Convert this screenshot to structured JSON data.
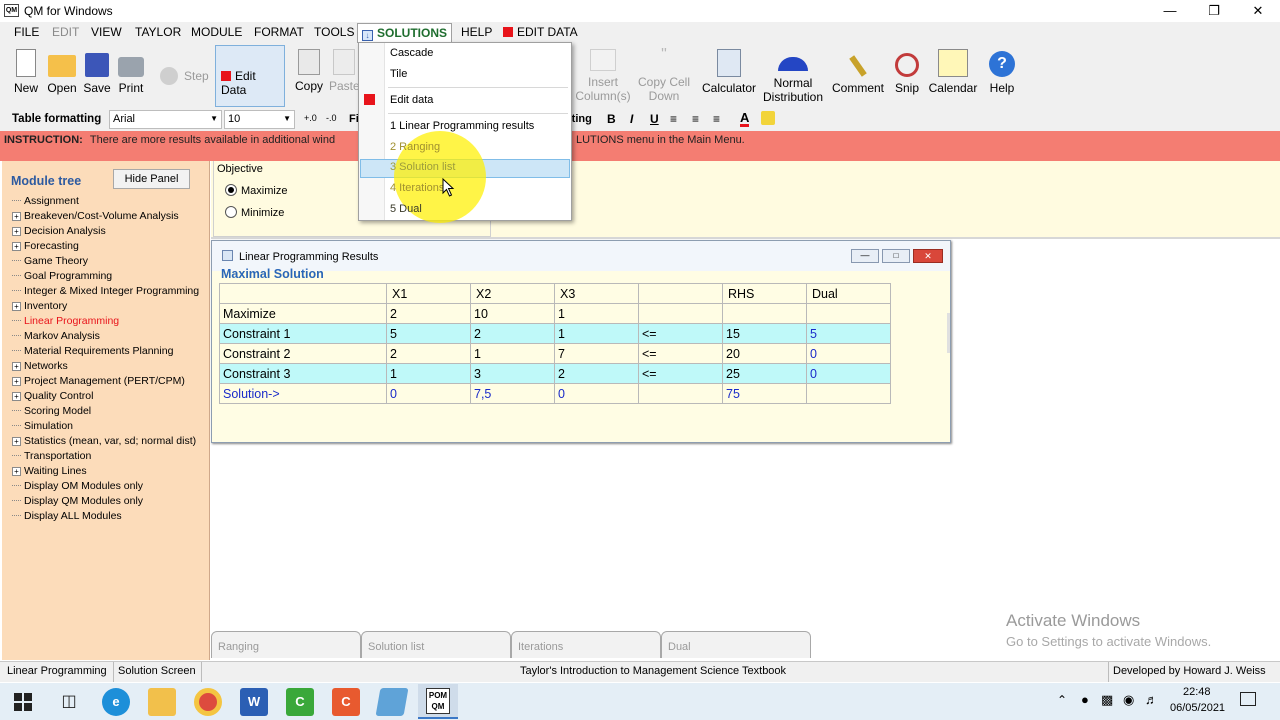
{
  "window": {
    "title": "QM for Windows",
    "app_icon": "QM"
  },
  "menu": [
    "FILE",
    "EDIT",
    "VIEW",
    "TAYLOR",
    "MODULE",
    "FORMAT",
    "TOOLS"
  ],
  "menu_open": "SOLUTIONS",
  "menu_after": [
    "HELP"
  ],
  "menu_editdata": "EDIT DATA",
  "toolbar": {
    "new": "New",
    "open": "Open",
    "save": "Save",
    "print": "Print",
    "step": "Step",
    "edit_data": "Edit Data",
    "copy": "Copy",
    "paste": "Paste",
    "insert_col_1": "Insert",
    "insert_col_2": "Column(s)",
    "copy_cell_1": "Copy Cell",
    "copy_cell_2": "Down",
    "calculator": "Calculator",
    "normal_1": "Normal",
    "normal_2": "Distribution",
    "comment": "Comment",
    "snip": "Snip",
    "calendar": "Calendar",
    "help": "Help"
  },
  "formatbar": {
    "label": "Table formatting",
    "font": "Arial",
    "size": "10",
    "frag_left": "Fi",
    "frag_right": "tting",
    "bold": "B",
    "italic": "I",
    "underline": "U",
    "color_a": "A"
  },
  "instruction": {
    "label": "INSTRUCTION:",
    "text_left": "There are more results available in additional wind",
    "text_right": "LUTIONS menu in the Main Menu."
  },
  "leftpanel": {
    "title": "Module tree",
    "hide_button": "Hide Panel",
    "items": [
      {
        "label": "Assignment",
        "expand": false
      },
      {
        "label": "Breakeven/Cost-Volume Analysis",
        "expand": true
      },
      {
        "label": "Decision Analysis",
        "expand": true
      },
      {
        "label": "Forecasting",
        "expand": true
      },
      {
        "label": "Game Theory",
        "expand": false
      },
      {
        "label": "Goal Programming",
        "expand": false
      },
      {
        "label": "Integer & Mixed Integer Programming",
        "expand": false
      },
      {
        "label": "Inventory",
        "expand": true
      },
      {
        "label": "Linear Programming",
        "expand": false,
        "active": true
      },
      {
        "label": "Markov Analysis",
        "expand": false
      },
      {
        "label": "Material Requirements Planning",
        "expand": false
      },
      {
        "label": "Networks",
        "expand": true
      },
      {
        "label": "Project Management (PERT/CPM)",
        "expand": true
      },
      {
        "label": "Quality Control",
        "expand": true
      },
      {
        "label": "Scoring Model",
        "expand": false
      },
      {
        "label": "Simulation",
        "expand": false
      },
      {
        "label": "Statistics (mean, var, sd; normal dist)",
        "expand": true
      },
      {
        "label": "Transportation",
        "expand": false
      },
      {
        "label": "Waiting Lines",
        "expand": true
      },
      {
        "label": "Display OM Modules only",
        "expand": false
      },
      {
        "label": "Display QM Modules only",
        "expand": false
      },
      {
        "label": "Display ALL Modules",
        "expand": false
      }
    ]
  },
  "objective": {
    "label": "Objective",
    "maximize": "Maximize",
    "minimize": "Minimize",
    "selected": "Maximize"
  },
  "results": {
    "title": "Linear Programming Results",
    "heading": "Maximal Solution",
    "columns": [
      "",
      "X1",
      "X2",
      "X3",
      "",
      "RHS",
      "Dual"
    ],
    "rows": [
      [
        "Maximize",
        "2",
        "10",
        "1",
        "",
        "",
        ""
      ],
      [
        "Constraint 1",
        "5",
        "2",
        "1",
        "<=",
        "15",
        "5"
      ],
      [
        "Constraint 2",
        "2",
        "1",
        "7",
        "<=",
        "20",
        "0"
      ],
      [
        "Constraint 3",
        "1",
        "3",
        "2",
        "<=",
        "25",
        "0"
      ],
      [
        "Solution->",
        "0",
        "7,5",
        "0",
        "",
        "75",
        ""
      ]
    ]
  },
  "dropdown": {
    "items": [
      "Cascade",
      "Tile",
      "Edit data",
      "1 Linear Programming results",
      "2 Ranging",
      "3 Solution list",
      "4 Iterations",
      "5 Dual"
    ],
    "highlighted": "3 Solution list"
  },
  "bottom_tabs": [
    "Ranging",
    "Solution list",
    "Iterations",
    "Dual"
  ],
  "statusbar": {
    "module": "Linear Programming",
    "screen": "Solution Screen",
    "center": "Taylor's Introduction to Management Science Textbook",
    "right": "Developed by Howard J. Weiss"
  },
  "watermark": {
    "line1": "Activate Windows",
    "line2": "Go to Settings to activate Windows."
  },
  "taskbar": {
    "time": "22:48",
    "date": "06/05/2021",
    "pom_label_1": "POM",
    "pom_label_2": "QM"
  },
  "colors": {
    "instruction": "#f47d72",
    "panel": "#fcdcba",
    "cyan_row": "#bff9f9",
    "active_module": "#e8141b",
    "link_blue": "#1a2bc9"
  }
}
